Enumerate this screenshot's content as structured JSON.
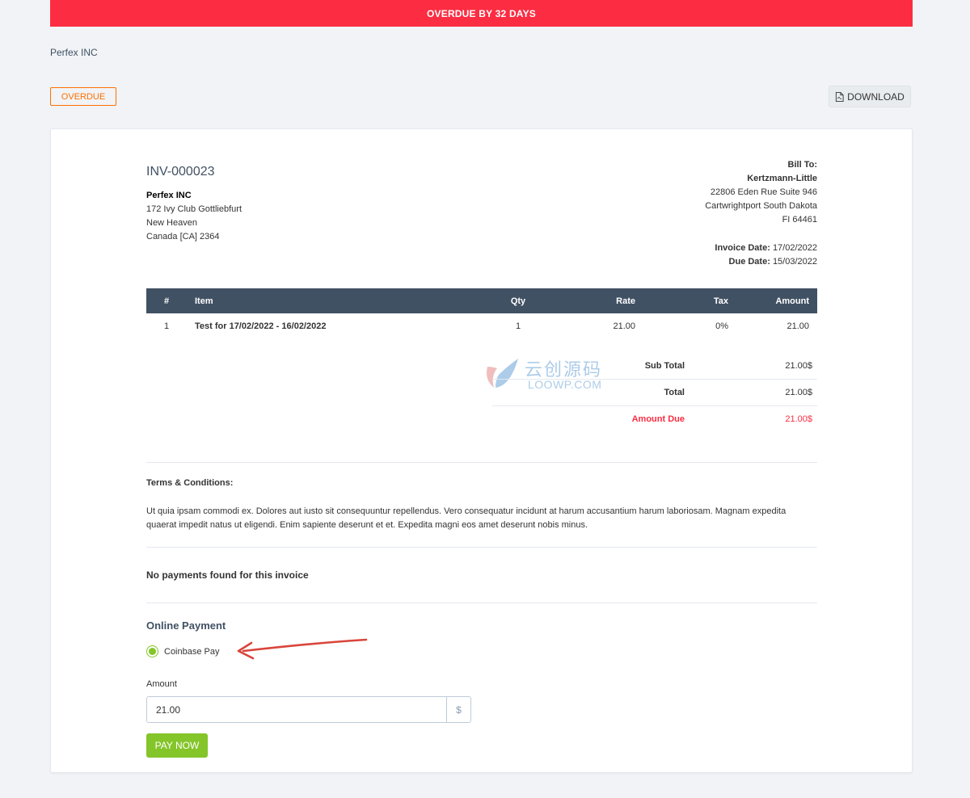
{
  "banner": {
    "text": "OVERDUE BY 32 DAYS",
    "color": "#fc2d42"
  },
  "company_link": "Perfex INC",
  "status_label": "OVERDUE",
  "download_button": {
    "label": "DOWNLOAD",
    "icon": "pdf-file-icon"
  },
  "invoice": {
    "number": "INV-000023",
    "from": {
      "name": "Perfex INC",
      "lines": [
        "172 Ivy Club Gottliebfurt",
        "New Heaven",
        "Canada [CA] 2364"
      ]
    },
    "bill_to": {
      "heading": "Bill To:",
      "name": "Kertzmann-Little",
      "lines": [
        "22806 Eden Rue Suite 946",
        "Cartwrightport South Dakota",
        "FI 64461"
      ]
    },
    "invoice_date": {
      "label": "Invoice Date:",
      "value": "17/02/2022"
    },
    "due_date": {
      "label": "Due Date:",
      "value": "15/03/2022"
    },
    "columns": [
      "#",
      "Item",
      "Qty",
      "Rate",
      "Tax",
      "Amount"
    ],
    "rows": [
      {
        "num": "1",
        "item": "Test for 17/02/2022 - 16/02/2022",
        "qty": "1",
        "rate": "21.00",
        "tax": "0%",
        "amount": "21.00"
      }
    ],
    "totals": {
      "sub_total": {
        "label": "Sub Total",
        "value": "21.00$"
      },
      "total": {
        "label": "Total",
        "value": "21.00$"
      },
      "amount_due": {
        "label": "Amount Due",
        "value": "21.00$"
      }
    }
  },
  "watermark": {
    "zh": "云创源码",
    "en": "LOOWP.COM"
  },
  "terms": {
    "title": "Terms & Conditions:",
    "text": "Ut quia ipsam commodi ex. Dolores aut iusto sit consequuntur repellendus. Vero consequatur incidunt at harum accusantium harum laboriosam. Magnam expedita quaerat impedit natus ut eligendi. Enim sapiente deserunt et et. Expedita magni eos amet deserunt nobis minus."
  },
  "payments_message": "No payments found for this invoice",
  "online_payment": {
    "title": "Online Payment",
    "gateway": "Coinbase Pay",
    "amount_label": "Amount",
    "amount_value": "21.00",
    "currency_symbol": "$",
    "pay_button": "PAY NOW"
  },
  "colors": {
    "primary": "#415164",
    "success": "#84c529",
    "danger": "#fc2d42",
    "warning": "#ff6f00"
  }
}
